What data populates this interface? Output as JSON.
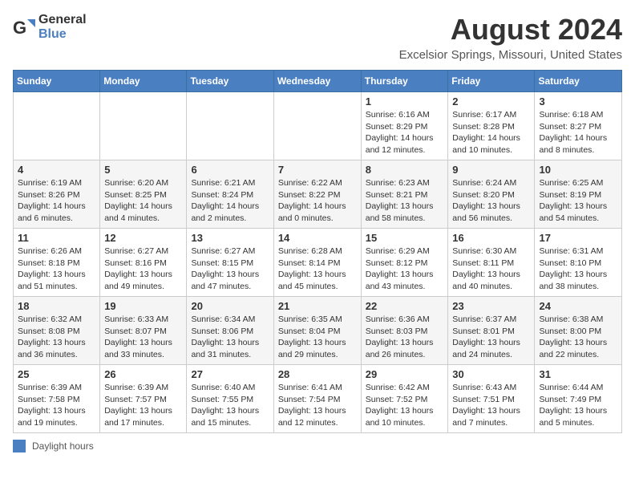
{
  "logo": {
    "text_general": "General",
    "text_blue": "Blue"
  },
  "header": {
    "title": "August 2024",
    "subtitle": "Excelsior Springs, Missouri, United States"
  },
  "weekdays": [
    "Sunday",
    "Monday",
    "Tuesday",
    "Wednesday",
    "Thursday",
    "Friday",
    "Saturday"
  ],
  "weeks": [
    [
      {
        "day": "",
        "info": ""
      },
      {
        "day": "",
        "info": ""
      },
      {
        "day": "",
        "info": ""
      },
      {
        "day": "",
        "info": ""
      },
      {
        "day": "1",
        "info": "Sunrise: 6:16 AM\nSunset: 8:29 PM\nDaylight: 14 hours\nand 12 minutes."
      },
      {
        "day": "2",
        "info": "Sunrise: 6:17 AM\nSunset: 8:28 PM\nDaylight: 14 hours\nand 10 minutes."
      },
      {
        "day": "3",
        "info": "Sunrise: 6:18 AM\nSunset: 8:27 PM\nDaylight: 14 hours\nand 8 minutes."
      }
    ],
    [
      {
        "day": "4",
        "info": "Sunrise: 6:19 AM\nSunset: 8:26 PM\nDaylight: 14 hours\nand 6 minutes."
      },
      {
        "day": "5",
        "info": "Sunrise: 6:20 AM\nSunset: 8:25 PM\nDaylight: 14 hours\nand 4 minutes."
      },
      {
        "day": "6",
        "info": "Sunrise: 6:21 AM\nSunset: 8:24 PM\nDaylight: 14 hours\nand 2 minutes."
      },
      {
        "day": "7",
        "info": "Sunrise: 6:22 AM\nSunset: 8:22 PM\nDaylight: 14 hours\nand 0 minutes."
      },
      {
        "day": "8",
        "info": "Sunrise: 6:23 AM\nSunset: 8:21 PM\nDaylight: 13 hours\nand 58 minutes."
      },
      {
        "day": "9",
        "info": "Sunrise: 6:24 AM\nSunset: 8:20 PM\nDaylight: 13 hours\nand 56 minutes."
      },
      {
        "day": "10",
        "info": "Sunrise: 6:25 AM\nSunset: 8:19 PM\nDaylight: 13 hours\nand 54 minutes."
      }
    ],
    [
      {
        "day": "11",
        "info": "Sunrise: 6:26 AM\nSunset: 8:18 PM\nDaylight: 13 hours\nand 51 minutes."
      },
      {
        "day": "12",
        "info": "Sunrise: 6:27 AM\nSunset: 8:16 PM\nDaylight: 13 hours\nand 49 minutes."
      },
      {
        "day": "13",
        "info": "Sunrise: 6:27 AM\nSunset: 8:15 PM\nDaylight: 13 hours\nand 47 minutes."
      },
      {
        "day": "14",
        "info": "Sunrise: 6:28 AM\nSunset: 8:14 PM\nDaylight: 13 hours\nand 45 minutes."
      },
      {
        "day": "15",
        "info": "Sunrise: 6:29 AM\nSunset: 8:12 PM\nDaylight: 13 hours\nand 43 minutes."
      },
      {
        "day": "16",
        "info": "Sunrise: 6:30 AM\nSunset: 8:11 PM\nDaylight: 13 hours\nand 40 minutes."
      },
      {
        "day": "17",
        "info": "Sunrise: 6:31 AM\nSunset: 8:10 PM\nDaylight: 13 hours\nand 38 minutes."
      }
    ],
    [
      {
        "day": "18",
        "info": "Sunrise: 6:32 AM\nSunset: 8:08 PM\nDaylight: 13 hours\nand 36 minutes."
      },
      {
        "day": "19",
        "info": "Sunrise: 6:33 AM\nSunset: 8:07 PM\nDaylight: 13 hours\nand 33 minutes."
      },
      {
        "day": "20",
        "info": "Sunrise: 6:34 AM\nSunset: 8:06 PM\nDaylight: 13 hours\nand 31 minutes."
      },
      {
        "day": "21",
        "info": "Sunrise: 6:35 AM\nSunset: 8:04 PM\nDaylight: 13 hours\nand 29 minutes."
      },
      {
        "day": "22",
        "info": "Sunrise: 6:36 AM\nSunset: 8:03 PM\nDaylight: 13 hours\nand 26 minutes."
      },
      {
        "day": "23",
        "info": "Sunrise: 6:37 AM\nSunset: 8:01 PM\nDaylight: 13 hours\nand 24 minutes."
      },
      {
        "day": "24",
        "info": "Sunrise: 6:38 AM\nSunset: 8:00 PM\nDaylight: 13 hours\nand 22 minutes."
      }
    ],
    [
      {
        "day": "25",
        "info": "Sunrise: 6:39 AM\nSunset: 7:58 PM\nDaylight: 13 hours\nand 19 minutes."
      },
      {
        "day": "26",
        "info": "Sunrise: 6:39 AM\nSunset: 7:57 PM\nDaylight: 13 hours\nand 17 minutes."
      },
      {
        "day": "27",
        "info": "Sunrise: 6:40 AM\nSunset: 7:55 PM\nDaylight: 13 hours\nand 15 minutes."
      },
      {
        "day": "28",
        "info": "Sunrise: 6:41 AM\nSunset: 7:54 PM\nDaylight: 13 hours\nand 12 minutes."
      },
      {
        "day": "29",
        "info": "Sunrise: 6:42 AM\nSunset: 7:52 PM\nDaylight: 13 hours\nand 10 minutes."
      },
      {
        "day": "30",
        "info": "Sunrise: 6:43 AM\nSunset: 7:51 PM\nDaylight: 13 hours\nand 7 minutes."
      },
      {
        "day": "31",
        "info": "Sunrise: 6:44 AM\nSunset: 7:49 PM\nDaylight: 13 hours\nand 5 minutes."
      }
    ]
  ],
  "legend": {
    "label": "Daylight hours"
  }
}
